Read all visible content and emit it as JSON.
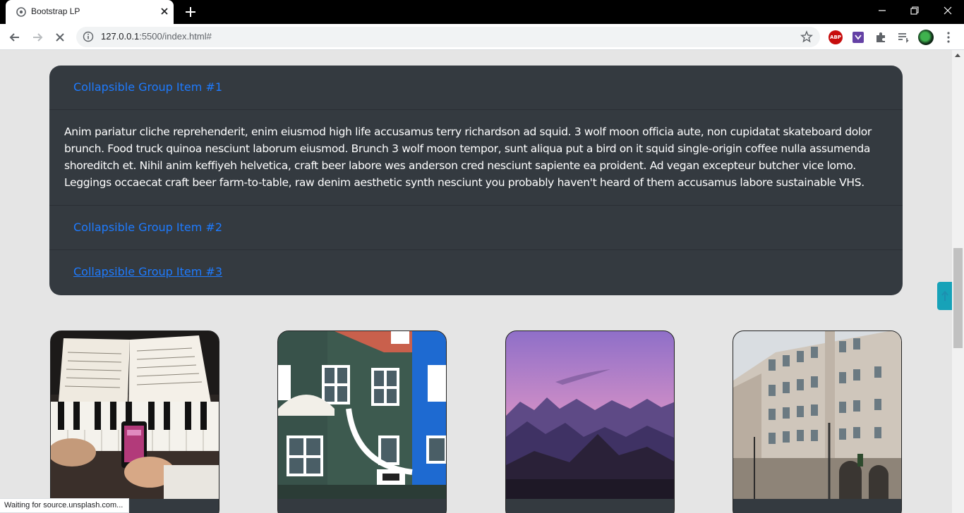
{
  "browser": {
    "tab_title": "Bootstrap LP",
    "url_host": "127.0.0.1",
    "url_rest": ":5500/index.html#",
    "extensions": [
      "adblock-plus-icon",
      "purple-extension-icon",
      "puzzle-extensions-icon",
      "reading-list-icon",
      "profile-avatar"
    ],
    "abp_label": "ABP"
  },
  "accordion": {
    "items": [
      {
        "label": "Collapsible Group Item #1",
        "expanded": true
      },
      {
        "label": "Collapsible Group Item #2",
        "expanded": false
      },
      {
        "label": "Collapsible Group Item #3",
        "expanded": false
      }
    ],
    "body_text": "Anim pariatur cliche reprehenderit, enim eiusmod high life accusamus terry richardson ad squid. 3 wolf moon officia aute, non cupidatat skateboard dolor brunch. Food truck quinoa nesciunt laborum eiusmod. Brunch 3 wolf moon tempor, sunt aliqua put a bird on it squid single-origin coffee nulla assumenda shoreditch et. Nihil anim keffiyeh helvetica, craft beer labore wes anderson cred nesciunt sapiente ea proident. Ad vegan excepteur butcher vice lomo. Leggings occaecat craft beer farm-to-table, raw denim aesthetic synth nesciunt you probably haven't heard of them accusamus labore sustainable VHS."
  },
  "cards": [
    {
      "image": "piano-notebook-photo"
    },
    {
      "image": "colorful-houses-photo"
    },
    {
      "image": "purple-sunset-mountains-photo"
    },
    {
      "image": "old-building-photo"
    }
  ],
  "status_bar": {
    "text": "Waiting for source.unsplash.com..."
  },
  "colors": {
    "accordion_bg": "#343a40",
    "link": "#1e7bff",
    "page_bg": "#e5e5e5",
    "scroll_top": "#17a2b8"
  }
}
